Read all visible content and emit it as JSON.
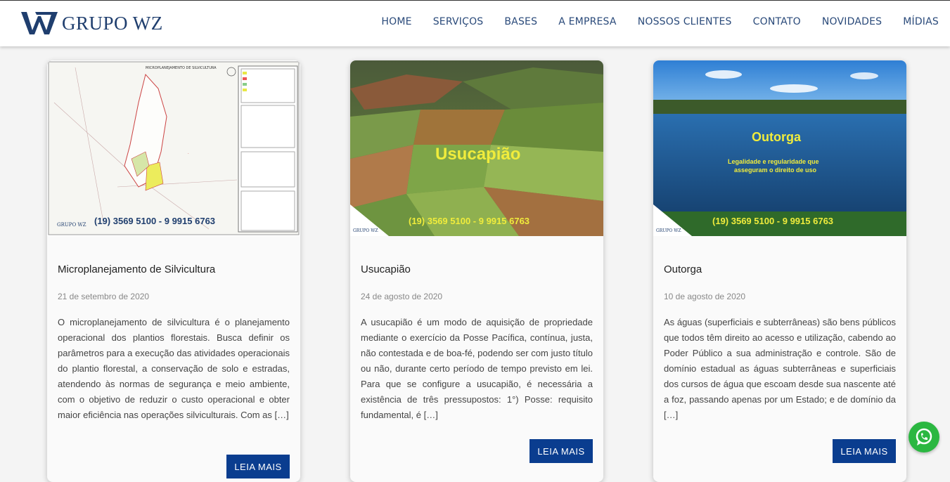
{
  "brand": {
    "name": "GRUPO WZ",
    "accent": "#1f3e6e",
    "button_color": "#0a3d8f"
  },
  "nav": {
    "items": [
      "HOME",
      "SERVIÇOS",
      "BASES",
      "A EMPRESA",
      "NOSSOS CLIENTES",
      "CONTATO",
      "NOVIDADES",
      "MÍDIAS"
    ]
  },
  "posts": [
    {
      "title": "Microplanejamento de Silvicultura",
      "date": "21 de setembro de 2020",
      "excerpt": "O microplanejamento de silvicultura é o planejamento operacional dos plantios florestais. Busca definir os parâmetros para a execução das atividades operacionais do plantio florestal, a conservação de solo e estradas, atendendo às normas de segurança e meio ambiente, com o objetivo de reduzir o custo operacional e obter maior eficiência nas operações silviculturais. Com as […]",
      "button": "LEIA MAIS",
      "image": {
        "heading": "MICROPLANEJAMENTO DE SILVICULTURA",
        "phone": "(19) 3569 5100 - 9 9915 6763",
        "logo": "GRUPO WZ"
      }
    },
    {
      "title": "Usucapião",
      "date": "24 de agosto de 2020",
      "excerpt": "A usucapião é um modo de aquisição de propriedade mediante o exercício da Posse Pacífica, contínua, justa, não contestada e de boa-fé, podendo ser com justo título ou não, durante certo período de tempo previsto em lei. Para que se configure a usucapião, é necessária a existência de três pressupostos: 1°) Posse: requisito fundamental, é […]",
      "button": "LEIA MAIS",
      "image": {
        "heading": "Usucapião",
        "phone": "(19) 3569 5100 - 9 9915 6763",
        "logo": "GRUPO WZ"
      }
    },
    {
      "title": "Outorga",
      "date": "10 de agosto de 2020",
      "excerpt": "As águas (superficiais e subterrâneas) são bens públicos que todos têm direito ao acesso e utilização, cabendo ao Poder Público a sua administração e controle. São de domínio estadual as águas subterrâneas e superficiais dos cursos de água que escoam desde sua nascente até a foz, passando apenas por um Estado; e de domínio da […]",
      "button": "LEIA MAIS",
      "image": {
        "heading": "Outorga",
        "subheading_1": "Legalidade e regularidade que",
        "subheading_2": "asseguram o direito de uso",
        "phone": "(19) 3569 5100 - 9 9915 6763",
        "logo": "GRUPO WZ"
      }
    }
  ],
  "icons": {
    "whatsapp": "whatsapp-icon",
    "logo": "wz-logo-icon"
  }
}
